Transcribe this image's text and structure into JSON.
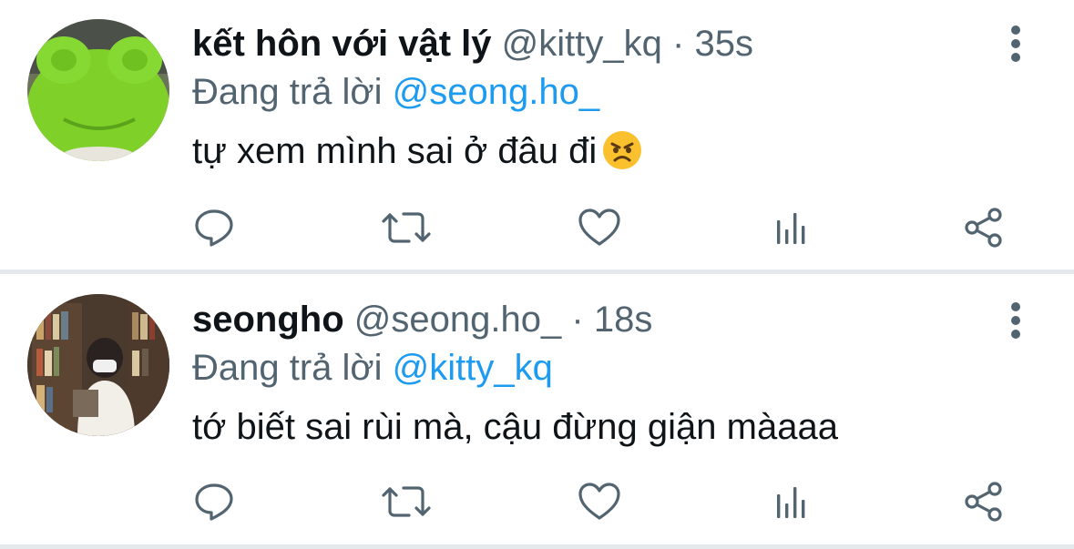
{
  "tweets": [
    {
      "display_name": "kết hôn với vật lý",
      "handle": "@kitty_kq",
      "separator": "·",
      "time": "35s",
      "reply_prefix": "Đang trả lời",
      "reply_to": "@seong.ho_",
      "text": "tự xem mình sai ở đâu đi",
      "emoji": "angry-face-emoji",
      "avatar": "green-frog-plush-avatar"
    },
    {
      "display_name": "seongho",
      "handle": "@seong.ho_",
      "separator": "·",
      "time": "18s",
      "reply_prefix": "Đang trả lời",
      "reply_to": "@kitty_kq",
      "text": "tớ biết sai rùi mà, cậu đừng giận màaaa",
      "avatar": "person-bookshelf-avatar"
    }
  ],
  "actions": [
    "reply-icon",
    "retweet-icon",
    "like-icon",
    "stats-icon",
    "share-icon"
  ],
  "colors": {
    "text": "#0f1419",
    "secondary": "#536471",
    "mention": "#1d9bf0",
    "divider": "#e6e9ec"
  }
}
